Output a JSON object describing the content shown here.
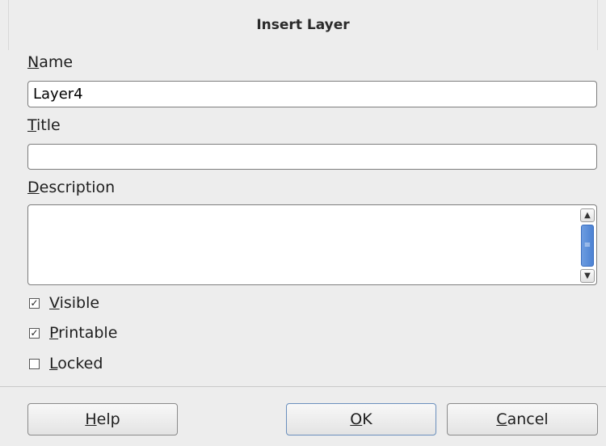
{
  "dialog": {
    "title": "Insert Layer",
    "name_label_mn": "N",
    "name_label_rest": "ame",
    "name_value": "Layer4",
    "title_label_mn": "T",
    "title_label_rest": "itle",
    "title_value": "",
    "description_label_mn": "D",
    "description_label_rest": "escription",
    "description_value": "",
    "options": [
      {
        "mn": "V",
        "rest": "isible",
        "checked": true
      },
      {
        "mn": "P",
        "rest": "rintable",
        "checked": true
      },
      {
        "mn": "L",
        "rest": "ocked",
        "checked": false
      }
    ],
    "buttons": {
      "help_mn": "H",
      "help_rest": "elp",
      "ok_mn": "O",
      "ok_rest": "K",
      "cancel_mn": "C",
      "cancel_rest": "ancel"
    }
  },
  "icons": {
    "scroll_up": "chevron-up-icon",
    "scroll_down": "chevron-down-icon",
    "checkbox_checked": "checkmark-icon"
  }
}
